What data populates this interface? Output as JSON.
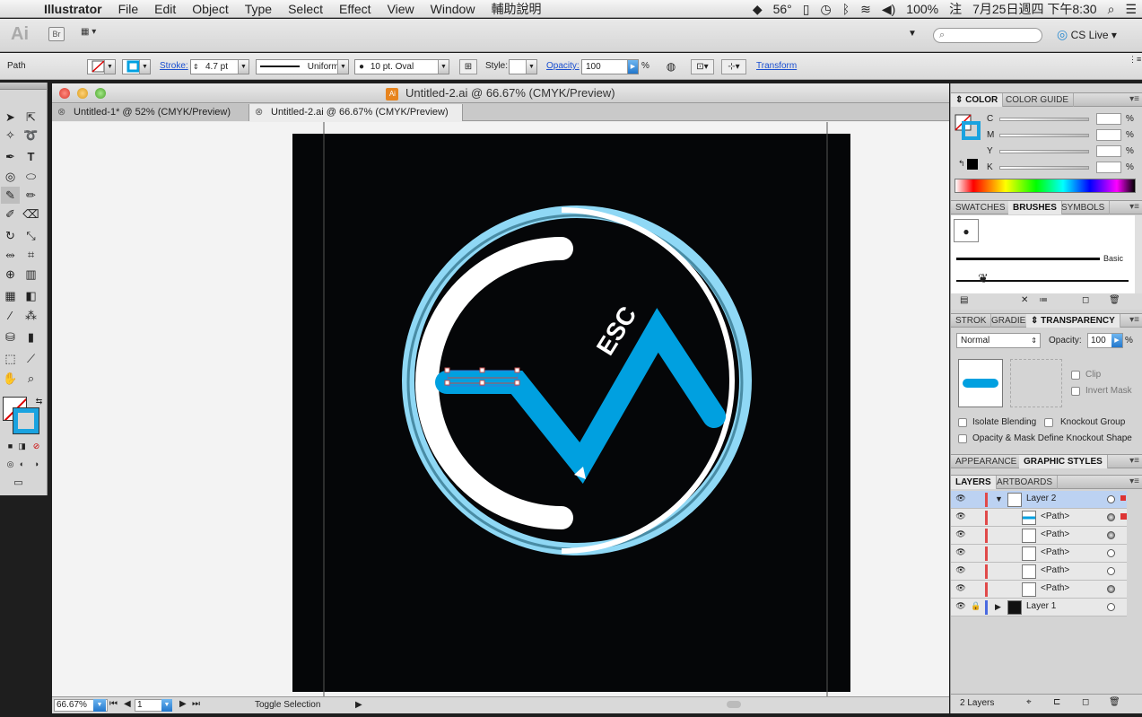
{
  "menubar": {
    "app": "Illustrator",
    "items": [
      "File",
      "Edit",
      "Object",
      "Type",
      "Select",
      "Effect",
      "View",
      "Window",
      "輔助說明"
    ],
    "temperature": "56°",
    "battery": "100%",
    "input_method": "注",
    "datetime": "7月25日週四 下午8:30"
  },
  "appbar": {
    "logo": "Ai",
    "bridge": "Br",
    "cslive": "CS Live"
  },
  "control": {
    "object_type": "Path",
    "stroke_label": "Stroke:",
    "stroke_weight": "4.7 pt",
    "profile": "Uniform",
    "brush": "10 pt. Oval",
    "style_label": "Style:",
    "opacity_label": "Opacity:",
    "opacity_value": "100",
    "opacity_unit": "%",
    "transform_label": "Transform"
  },
  "document": {
    "title": "Untitled-2.ai @ 66.67% (CMYK/Preview)",
    "tabs": [
      {
        "label": "Untitled-1* @ 52% (CMYK/Preview)",
        "active": false
      },
      {
        "label": "Untitled-2.ai @ 66.67% (CMYK/Preview)",
        "active": true
      }
    ],
    "artwork_text": "ESC",
    "zoom": "66.67%",
    "page": "1",
    "status": "Toggle Selection"
  },
  "panels": {
    "color_tabs": [
      "COLOR",
      "COLOR GUIDE"
    ],
    "cmyk": [
      "C",
      "M",
      "Y",
      "K"
    ],
    "cmyk_unit": "%",
    "brush_tabs": [
      "SWATCHES",
      "BRUSHES",
      "SYMBOLS"
    ],
    "brush_basic": "Basic",
    "transparency_tabs": [
      "STROK",
      "GRADIE",
      "TRANSPARENCY"
    ],
    "blend_mode": "Normal",
    "opacity_label": "Opacity:",
    "opacity_value": "100",
    "opacity_unit": "%",
    "clip": "Clip",
    "invert_mask": "Invert Mask",
    "isolate_blending": "Isolate Blending",
    "knockout_group": "Knockout Group",
    "opacity_mask": "Opacity & Mask Define Knockout Shape",
    "style_tabs": [
      "APPEARANCE",
      "GRAPHIC STYLES"
    ],
    "layer_tabs": [
      "LAYERS",
      "ARTBOARDS"
    ],
    "layers": [
      {
        "name": "Layer 2",
        "level": 0
      },
      {
        "name": "<Path>",
        "level": 1
      },
      {
        "name": "<Path>",
        "level": 1
      },
      {
        "name": "<Path>",
        "level": 1
      },
      {
        "name": "<Path>",
        "level": 1
      },
      {
        "name": "<Path>",
        "level": 1
      },
      {
        "name": "Layer 1",
        "level": 0
      }
    ],
    "layers_count": "2 Layers"
  },
  "colors": {
    "accent_blue": "#00a0e0",
    "light_blue": "#8fd8f5",
    "artboard": "#050608"
  }
}
